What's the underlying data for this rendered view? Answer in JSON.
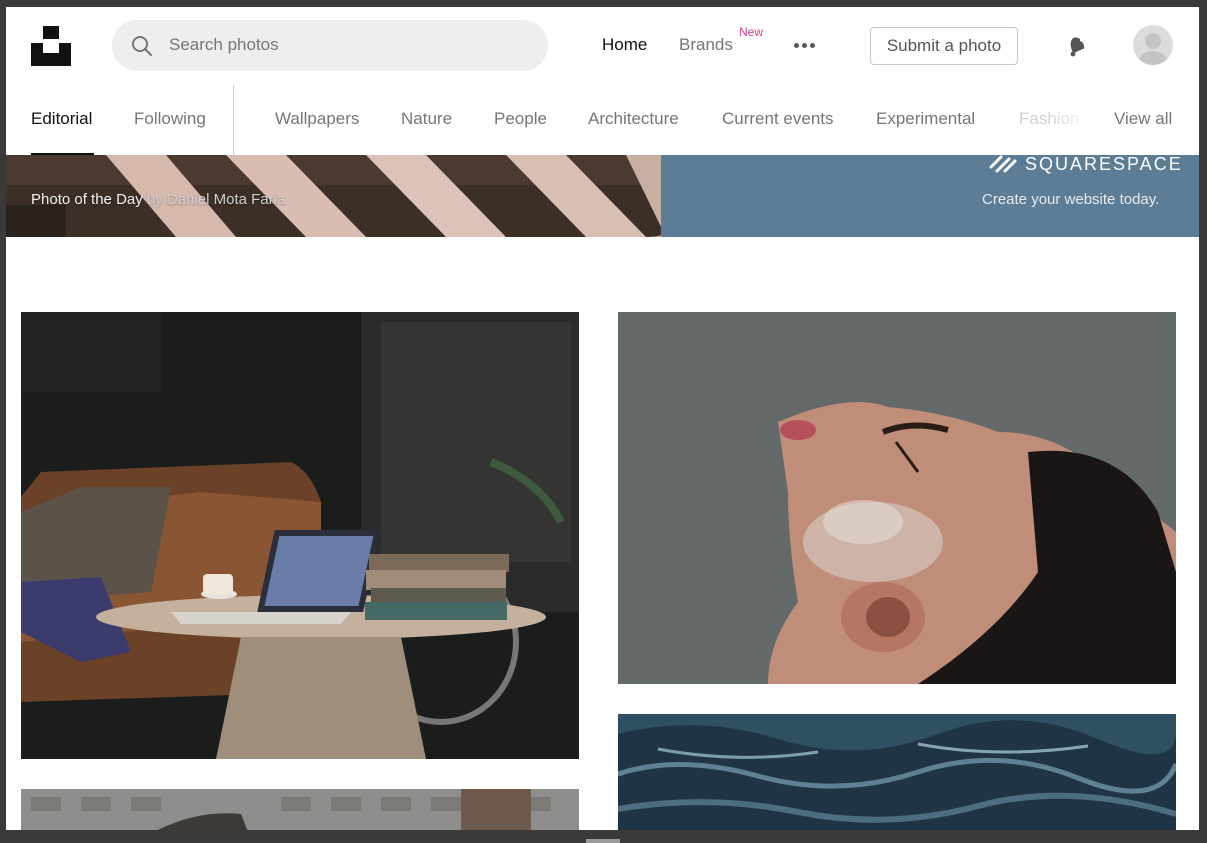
{
  "header": {
    "search_placeholder": "Search photos",
    "nav": {
      "home": "Home",
      "brands": "Brands",
      "brands_badge": "New"
    },
    "submit_label": "Submit a photo"
  },
  "tabs": [
    {
      "label": "Editorial",
      "active": true
    },
    {
      "label": "Following"
    },
    {
      "label": "Wallpapers"
    },
    {
      "label": "Nature"
    },
    {
      "label": "People"
    },
    {
      "label": "Architecture"
    },
    {
      "label": "Current events"
    },
    {
      "label": "Experimental"
    },
    {
      "label": "Fashion"
    },
    {
      "label": "View all"
    }
  ],
  "hero": {
    "caption_prefix": "Photo of the Day",
    "caption_by": "by",
    "caption_author": "Daniel Mota Faria",
    "ad_brand": "SQUARESPACE",
    "ad_tagline": "Create your website today."
  },
  "colors": {
    "accent_new": "#d93f87",
    "ad_background": "#5d7d96"
  },
  "icons": [
    "unsplash-logo",
    "search-icon",
    "more-icon",
    "bell-icon",
    "avatar",
    "squarespace-logo"
  ]
}
